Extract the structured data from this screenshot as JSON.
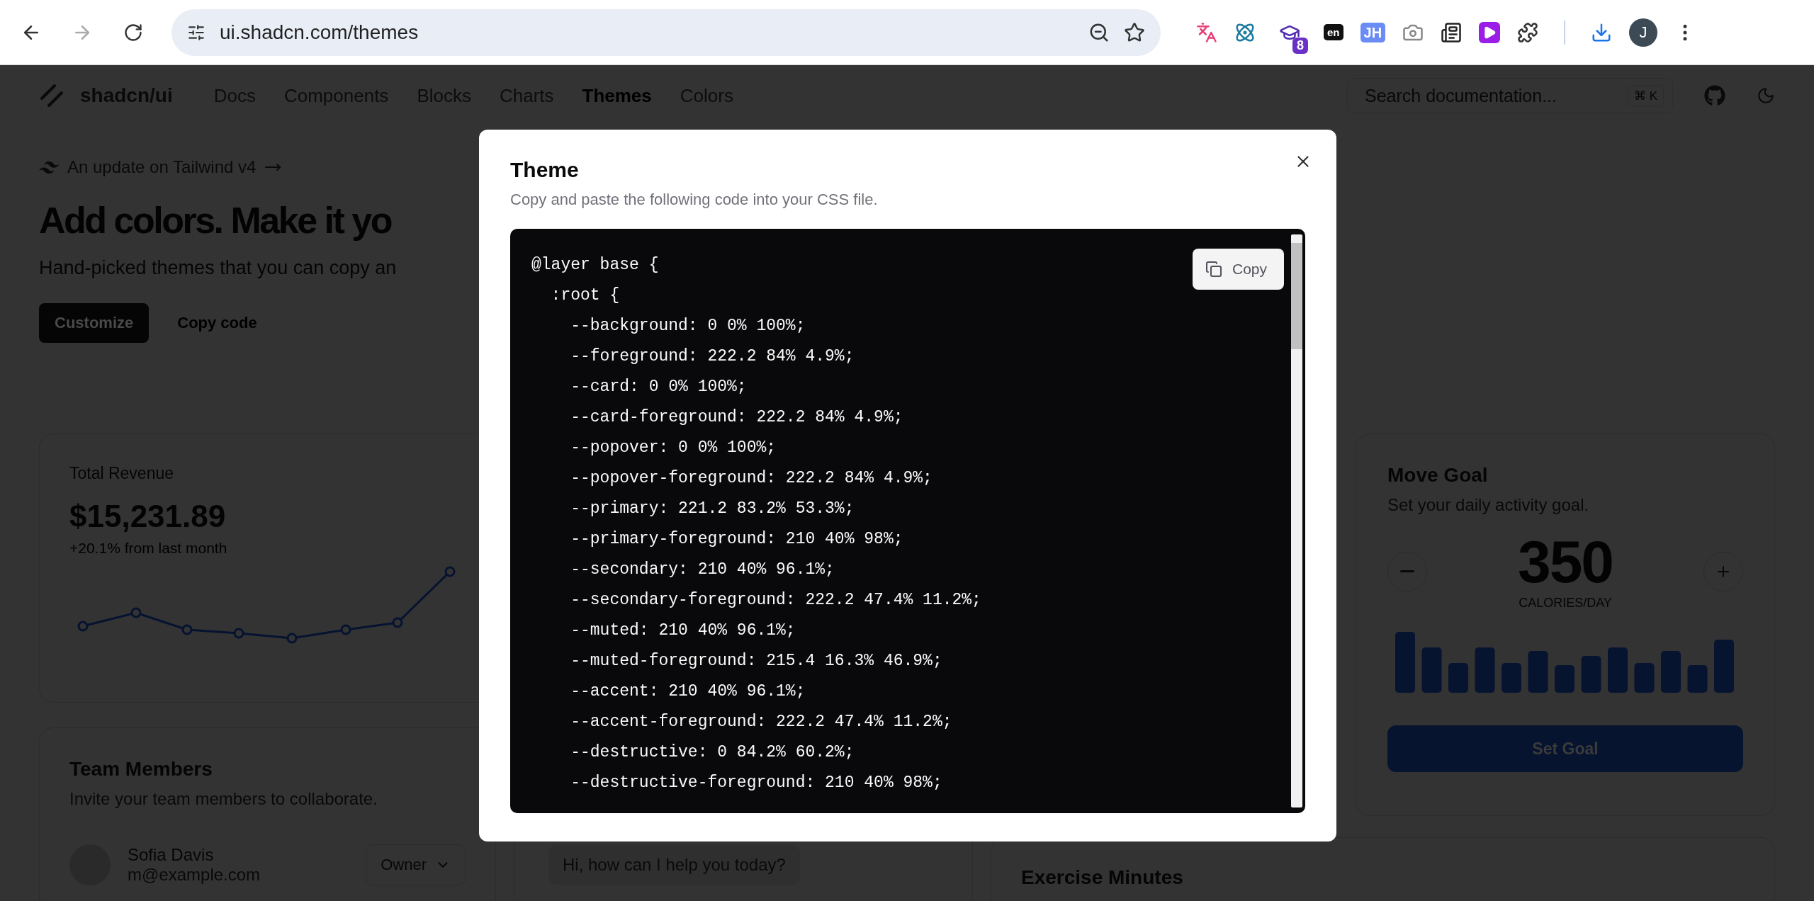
{
  "browser": {
    "url": "ui.shadcn.com/themes",
    "extensions": [
      {
        "kind": "translate"
      },
      {
        "kind": "atom"
      },
      {
        "kind": "cap",
        "badge": "8"
      },
      {
        "kind": "tag",
        "label": "en"
      },
      {
        "kind": "tag",
        "label": "JH"
      },
      {
        "kind": "camera"
      },
      {
        "kind": "reader"
      },
      {
        "kind": "play"
      }
    ],
    "profile_initial": "J"
  },
  "site": {
    "logo": "shadcn/ui",
    "nav": [
      {
        "label": "Docs",
        "selected": false
      },
      {
        "label": "Components",
        "selected": false
      },
      {
        "label": "Blocks",
        "selected": false
      },
      {
        "label": "Charts",
        "selected": false
      },
      {
        "label": "Themes",
        "selected": true
      },
      {
        "label": "Colors",
        "selected": false
      }
    ],
    "search": {
      "placeholder": "Search documentation...",
      "shortcut": "⌘ K"
    }
  },
  "hero": {
    "announcement": "An update on Tailwind v4",
    "title": "Add colors. Make it yo",
    "subtitle": "Hand-picked themes that you can copy an",
    "buttons": [
      {
        "label": "Customize",
        "kind": "primary"
      },
      {
        "label": "Copy code",
        "kind": "ghost"
      }
    ]
  },
  "revenue_card": {
    "title": "Total Revenue",
    "value": "$15,231.89",
    "change": "+20.1% from last month"
  },
  "team_card": {
    "title": "Team Members",
    "description": "Invite your team members to collaborate.",
    "members": [
      {
        "name": "Sofia Davis",
        "email": "m@example.com",
        "role": "Owner"
      }
    ]
  },
  "chat_card": {
    "messages": [
      {
        "text": "Hi, how can I help you today?"
      }
    ]
  },
  "move_goal_card": {
    "title": "Move Goal",
    "description": "Set your daily activity goal.",
    "value": "350",
    "unit": "CALORIES/DAY",
    "button": "Set Goal"
  },
  "exercise_card": {
    "title": "Exercise Minutes"
  },
  "dialog": {
    "title": "Theme",
    "description": "Copy and paste the following code into your CSS file.",
    "copy_button": "Copy",
    "code_lines": [
      "@layer base {",
      "  :root {",
      "    --background: 0 0% 100%;",
      "    --foreground: 222.2 84% 4.9%;",
      "    --card: 0 0% 100%;",
      "    --card-foreground: 222.2 84% 4.9%;",
      "    --popover: 0 0% 100%;",
      "    --popover-foreground: 222.2 84% 4.9%;",
      "    --primary: 221.2 83.2% 53.3%;",
      "    --primary-foreground: 210 40% 98%;",
      "    --secondary: 210 40% 96.1%;",
      "    --secondary-foreground: 222.2 47.4% 11.2%;",
      "    --muted: 210 40% 96.1%;",
      "    --muted-foreground: 215.4 16.3% 46.9%;",
      "    --accent: 210 40% 96.1%;",
      "    --accent-foreground: 222.2 47.4% 11.2%;",
      "    --destructive: 0 84.2% 60.2%;",
      "    --destructive-foreground: 210 40% 98%;"
    ]
  }
}
